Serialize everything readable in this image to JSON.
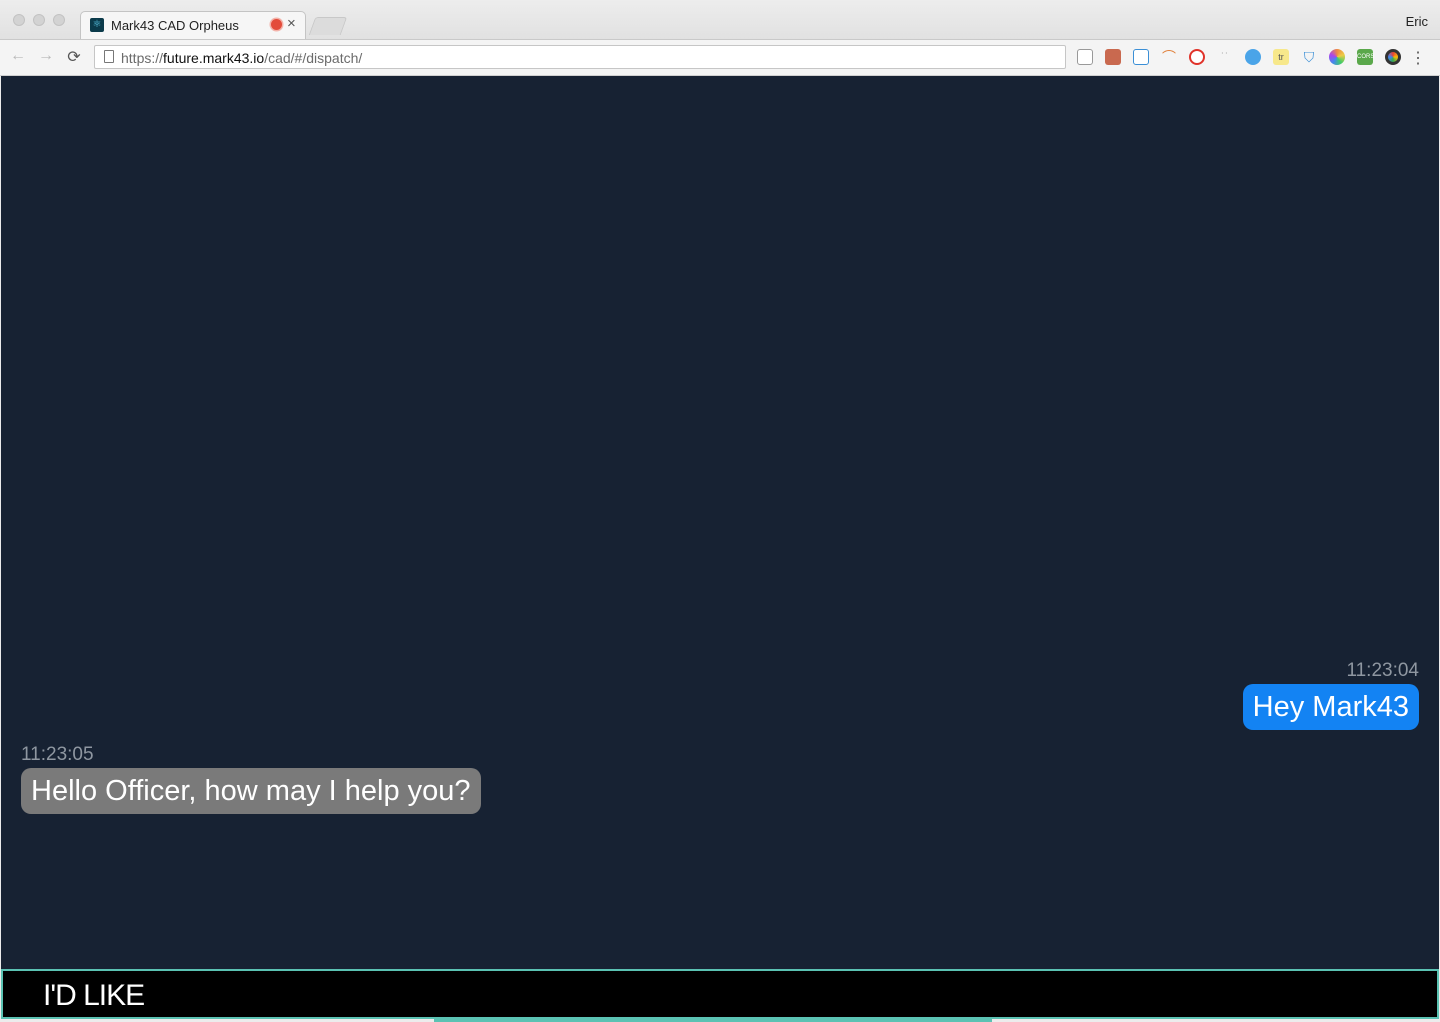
{
  "browser": {
    "tab_title": "Mark43 CAD Orpheus",
    "tab_close": "×",
    "profile_name": "Eric",
    "url_scheme": "https://",
    "url_host": "future.mark43.io",
    "url_path": "/cad/#/dispatch/",
    "nav": {
      "back": "←",
      "forward": "→",
      "reload": "⟳"
    },
    "extensions": [
      "note-icon",
      "pixel-icon",
      "frame-icon",
      "arc-icon",
      "opera-icon",
      "dots-icon",
      "feather-icon",
      "tr-icon",
      "shield-icon",
      "flower-icon",
      "cors-icon",
      "chrome-color-icon"
    ],
    "extension_labels": {
      "tr": "tr",
      "cors": "CORS"
    },
    "menu": "⋮"
  },
  "chat": {
    "messages": [
      {
        "time": "11:23:04",
        "text": "Hey Mark43",
        "sender": "user"
      },
      {
        "time": "11:23:05",
        "text": "Hello Officer, how may I help you?",
        "sender": "assistant"
      }
    ]
  },
  "input": {
    "transcript": "I'D LIKE"
  },
  "colors": {
    "background": "#172233",
    "user_bubble": "#1383f3",
    "assistant_bubble": "#7a7a7a",
    "input_border": "#5bc2b3",
    "wave": "#1e64c8"
  }
}
